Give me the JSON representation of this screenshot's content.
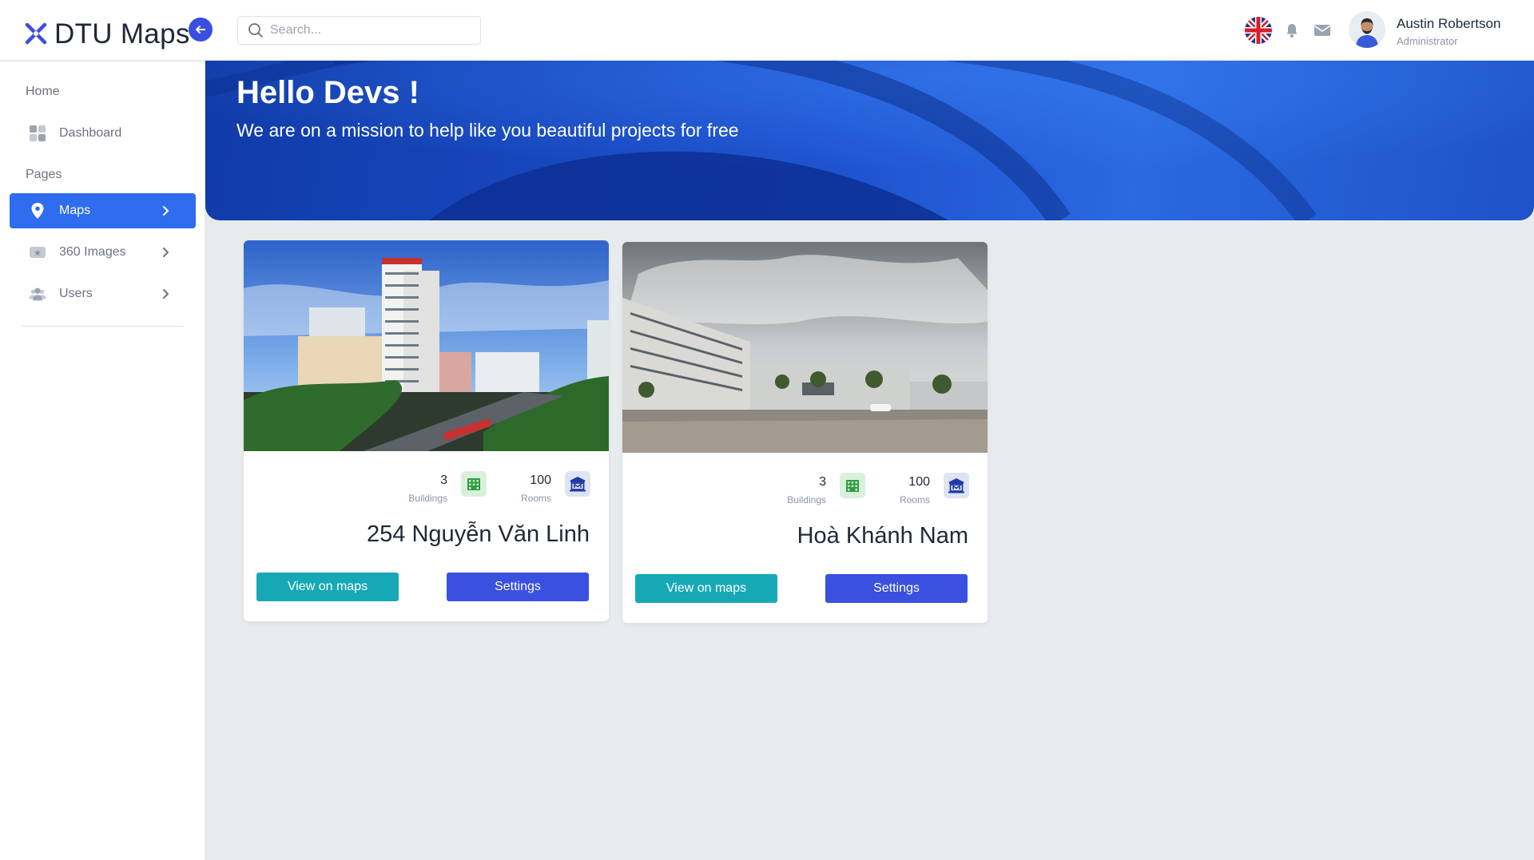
{
  "app": {
    "title": "DTU Maps"
  },
  "search": {
    "placeholder": "Search..."
  },
  "user": {
    "name": "Austin Robertson",
    "role": "Administrator"
  },
  "sidebar": {
    "sections": [
      {
        "label": "Home",
        "items": [
          {
            "label": "Dashboard",
            "icon": "dashboard-grid-icon",
            "active": false
          }
        ]
      },
      {
        "label": "Pages",
        "items": [
          {
            "label": "Maps",
            "icon": "map-pin-icon",
            "active": true
          },
          {
            "label": "360 Images",
            "icon": "image-360-icon",
            "active": false
          },
          {
            "label": "Users",
            "icon": "users-icon",
            "active": false
          }
        ]
      }
    ]
  },
  "banner": {
    "title": "Hello Devs !",
    "subtitle": "We are on a mission to help like you beautiful projects for free"
  },
  "campuses": [
    {
      "name": "254 Nguyễn Văn Linh",
      "buildings": "3",
      "buildings_label": "Buildings",
      "rooms": "100",
      "rooms_label": "Rooms",
      "view_label": "View on maps",
      "settings_label": "Settings"
    },
    {
      "name": "Hoà Khánh Nam",
      "buildings": "3",
      "buildings_label": "Buildings",
      "rooms": "100",
      "rooms_label": "Rooms",
      "view_label": "View on maps",
      "settings_label": "Settings"
    }
  ],
  "colors": {
    "accent": "#2f6cf0",
    "primary_button": "#3a50e0",
    "teal_button": "#16a9b5",
    "banner": "#1c4fcc"
  }
}
